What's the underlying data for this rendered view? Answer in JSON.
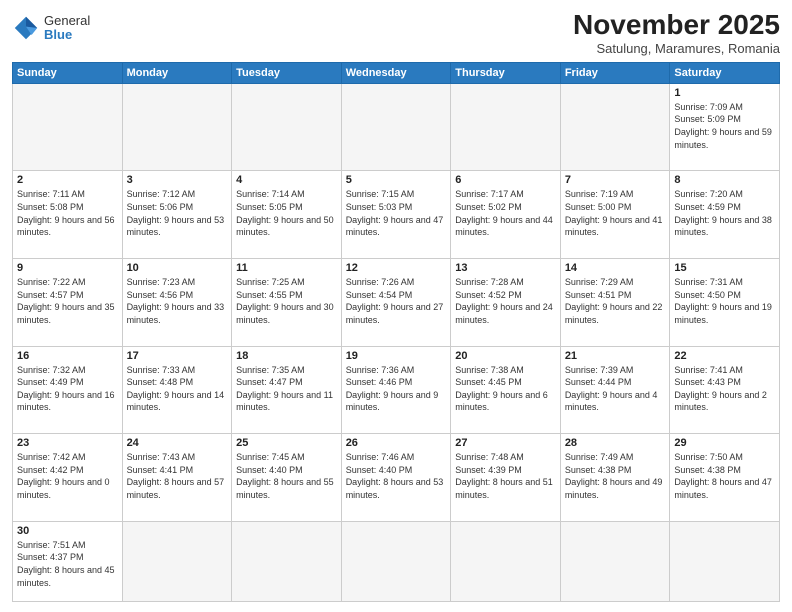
{
  "header": {
    "logo_general": "General",
    "logo_blue": "Blue",
    "month_title": "November 2025",
    "subtitle": "Satulung, Maramures, Romania"
  },
  "weekdays": [
    "Sunday",
    "Monday",
    "Tuesday",
    "Wednesday",
    "Thursday",
    "Friday",
    "Saturday"
  ],
  "weeks": [
    [
      {
        "day": "",
        "empty": true
      },
      {
        "day": "",
        "empty": true
      },
      {
        "day": "",
        "empty": true
      },
      {
        "day": "",
        "empty": true
      },
      {
        "day": "",
        "empty": true
      },
      {
        "day": "",
        "empty": true
      },
      {
        "day": "1",
        "sunrise": "7:09 AM",
        "sunset": "5:09 PM",
        "daylight": "9 hours and 59 minutes."
      }
    ],
    [
      {
        "day": "2",
        "sunrise": "7:11 AM",
        "sunset": "5:08 PM",
        "daylight": "9 hours and 56 minutes."
      },
      {
        "day": "3",
        "sunrise": "7:12 AM",
        "sunset": "5:06 PM",
        "daylight": "9 hours and 53 minutes."
      },
      {
        "day": "4",
        "sunrise": "7:14 AM",
        "sunset": "5:05 PM",
        "daylight": "9 hours and 50 minutes."
      },
      {
        "day": "5",
        "sunrise": "7:15 AM",
        "sunset": "5:03 PM",
        "daylight": "9 hours and 47 minutes."
      },
      {
        "day": "6",
        "sunrise": "7:17 AM",
        "sunset": "5:02 PM",
        "daylight": "9 hours and 44 minutes."
      },
      {
        "day": "7",
        "sunrise": "7:19 AM",
        "sunset": "5:00 PM",
        "daylight": "9 hours and 41 minutes."
      },
      {
        "day": "8",
        "sunrise": "7:20 AM",
        "sunset": "4:59 PM",
        "daylight": "9 hours and 38 minutes."
      }
    ],
    [
      {
        "day": "9",
        "sunrise": "7:22 AM",
        "sunset": "4:57 PM",
        "daylight": "9 hours and 35 minutes."
      },
      {
        "day": "10",
        "sunrise": "7:23 AM",
        "sunset": "4:56 PM",
        "daylight": "9 hours and 33 minutes."
      },
      {
        "day": "11",
        "sunrise": "7:25 AM",
        "sunset": "4:55 PM",
        "daylight": "9 hours and 30 minutes."
      },
      {
        "day": "12",
        "sunrise": "7:26 AM",
        "sunset": "4:54 PM",
        "daylight": "9 hours and 27 minutes."
      },
      {
        "day": "13",
        "sunrise": "7:28 AM",
        "sunset": "4:52 PM",
        "daylight": "9 hours and 24 minutes."
      },
      {
        "day": "14",
        "sunrise": "7:29 AM",
        "sunset": "4:51 PM",
        "daylight": "9 hours and 22 minutes."
      },
      {
        "day": "15",
        "sunrise": "7:31 AM",
        "sunset": "4:50 PM",
        "daylight": "9 hours and 19 minutes."
      }
    ],
    [
      {
        "day": "16",
        "sunrise": "7:32 AM",
        "sunset": "4:49 PM",
        "daylight": "9 hours and 16 minutes."
      },
      {
        "day": "17",
        "sunrise": "7:33 AM",
        "sunset": "4:48 PM",
        "daylight": "9 hours and 14 minutes."
      },
      {
        "day": "18",
        "sunrise": "7:35 AM",
        "sunset": "4:47 PM",
        "daylight": "9 hours and 11 minutes."
      },
      {
        "day": "19",
        "sunrise": "7:36 AM",
        "sunset": "4:46 PM",
        "daylight": "9 hours and 9 minutes."
      },
      {
        "day": "20",
        "sunrise": "7:38 AM",
        "sunset": "4:45 PM",
        "daylight": "9 hours and 6 minutes."
      },
      {
        "day": "21",
        "sunrise": "7:39 AM",
        "sunset": "4:44 PM",
        "daylight": "9 hours and 4 minutes."
      },
      {
        "day": "22",
        "sunrise": "7:41 AM",
        "sunset": "4:43 PM",
        "daylight": "9 hours and 2 minutes."
      }
    ],
    [
      {
        "day": "23",
        "sunrise": "7:42 AM",
        "sunset": "4:42 PM",
        "daylight": "9 hours and 0 minutes."
      },
      {
        "day": "24",
        "sunrise": "7:43 AM",
        "sunset": "4:41 PM",
        "daylight": "8 hours and 57 minutes."
      },
      {
        "day": "25",
        "sunrise": "7:45 AM",
        "sunset": "4:40 PM",
        "daylight": "8 hours and 55 minutes."
      },
      {
        "day": "26",
        "sunrise": "7:46 AM",
        "sunset": "4:40 PM",
        "daylight": "8 hours and 53 minutes."
      },
      {
        "day": "27",
        "sunrise": "7:48 AM",
        "sunset": "4:39 PM",
        "daylight": "8 hours and 51 minutes."
      },
      {
        "day": "28",
        "sunrise": "7:49 AM",
        "sunset": "4:38 PM",
        "daylight": "8 hours and 49 minutes."
      },
      {
        "day": "29",
        "sunrise": "7:50 AM",
        "sunset": "4:38 PM",
        "daylight": "8 hours and 47 minutes."
      }
    ],
    [
      {
        "day": "30",
        "sunrise": "7:51 AM",
        "sunset": "4:37 PM",
        "daylight": "8 hours and 45 minutes."
      },
      {
        "day": "",
        "empty": true
      },
      {
        "day": "",
        "empty": true
      },
      {
        "day": "",
        "empty": true
      },
      {
        "day": "",
        "empty": true
      },
      {
        "day": "",
        "empty": true
      },
      {
        "day": "",
        "empty": true
      }
    ]
  ]
}
